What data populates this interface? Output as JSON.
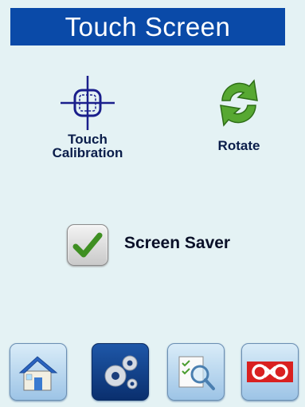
{
  "header": {
    "title": "Touch Screen"
  },
  "settings": {
    "touch_calibration": {
      "label_line1": "Touch",
      "label_line2": "Calibration",
      "icon": "crosshair-target-icon"
    },
    "rotate": {
      "label": "Rotate",
      "icon": "rotate-arrows-icon"
    },
    "screen_saver": {
      "label": "Screen Saver",
      "checked": true
    }
  },
  "nav": {
    "items": [
      {
        "name": "home",
        "icon": "home-icon",
        "active": false
      },
      {
        "name": "settings",
        "icon": "gears-icon",
        "active": true
      },
      {
        "name": "search",
        "icon": "document-search-icon",
        "active": false
      },
      {
        "name": "brand",
        "icon": "logo-icon",
        "active": false
      }
    ]
  },
  "colors": {
    "title_bar": "#0a4aa8",
    "background": "#e4f2f4",
    "accent_green": "#4a9d2f"
  }
}
